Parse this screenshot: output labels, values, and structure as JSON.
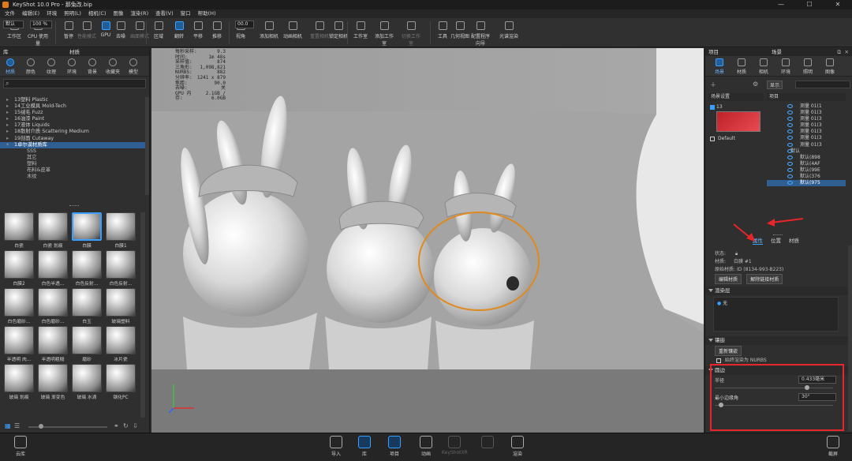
{
  "window": {
    "title": "KeyShot 10.0 Pro - 那兔改.bip",
    "controls": [
      "—",
      "☐",
      "✕"
    ]
  },
  "menu": [
    "文件",
    "编辑(E)",
    "环境",
    "照明(L)",
    "相机(C)",
    "图像",
    "渲染(R)",
    "查看(V)",
    "窗口",
    "帮助(H)"
  ],
  "toolbar": {
    "workspace_value": "默认",
    "cpu_value": "100 %",
    "focal_value": "00.0",
    "buttons": [
      {
        "label": "工作区",
        "state": "normal"
      },
      {
        "label": "CPU 使用量",
        "state": "normal"
      },
      {
        "label": "暂停",
        "state": "normal"
      },
      {
        "label": "性能模式",
        "state": "dim"
      },
      {
        "label": "GPU",
        "state": "active"
      },
      {
        "label": "去噪",
        "state": "normal"
      },
      {
        "label": "画面模式",
        "state": "dim"
      },
      {
        "label": "区域",
        "state": "normal"
      },
      {
        "label": "翻转",
        "state": "active"
      },
      {
        "label": "平移",
        "state": "normal"
      },
      {
        "label": "推移",
        "state": "normal"
      },
      {
        "label": "视角",
        "state": "normal"
      },
      {
        "label": "添加相机",
        "state": "normal"
      },
      {
        "label": "动画相机",
        "state": "normal"
      },
      {
        "label": "重置相机",
        "state": "dim"
      },
      {
        "label": "锁定相机",
        "state": "normal"
      },
      {
        "label": "工作室",
        "state": "normal"
      },
      {
        "label": "添加工作室",
        "state": "normal"
      },
      {
        "label": "切换工作室",
        "state": "dim"
      },
      {
        "label": "工具",
        "state": "normal"
      },
      {
        "label": "几何视图",
        "state": "normal"
      },
      {
        "label": "配置程序向导",
        "state": "normal"
      },
      {
        "label": "光谱渲染",
        "state": "normal"
      }
    ]
  },
  "library": {
    "header_left": "库",
    "header_title": "材质",
    "tabs": [
      {
        "label": "材质",
        "active": true,
        "icon": "material-icon"
      },
      {
        "label": "颜色",
        "active": false,
        "icon": "color-icon"
      },
      {
        "label": "纹理",
        "active": false,
        "icon": "texture-icon"
      },
      {
        "label": "环境",
        "active": false,
        "icon": "environment-icon"
      },
      {
        "label": "背景",
        "active": false,
        "icon": "background-icon"
      },
      {
        "label": "收藏夹",
        "active": false,
        "icon": "favorites-icon"
      },
      {
        "label": "模型",
        "active": false,
        "icon": "model-icon"
      }
    ],
    "tree": [
      {
        "label": "13塑料 Plastic",
        "type": "folder"
      },
      {
        "label": "14工业模具 Mold-Tech",
        "type": "folder"
      },
      {
        "label": "15绒毛 Fuzz",
        "type": "folder"
      },
      {
        "label": "16油漆 Paint",
        "type": "folder"
      },
      {
        "label": "17液体 Liquids",
        "type": "folder"
      },
      {
        "label": "18散射介质 Scattering Medium",
        "type": "folder"
      },
      {
        "label": "19剖面 Cutaway",
        "type": "folder"
      },
      {
        "label": "1卓尔谟材质库",
        "type": "selected"
      },
      {
        "label": "SSS",
        "type": "child"
      },
      {
        "label": "其它",
        "type": "child"
      },
      {
        "label": "塑料",
        "type": "child"
      },
      {
        "label": "布料&皮革",
        "type": "child"
      },
      {
        "label": "木纹",
        "type": "child"
      }
    ],
    "materials": [
      {
        "name": "白瓷",
        "sel": false
      },
      {
        "name": "白瓷 划痕",
        "sel": false
      },
      {
        "name": "白膜",
        "sel": true
      },
      {
        "name": "白膜1",
        "sel": false
      },
      {
        "name": "白膜2",
        "sel": false
      },
      {
        "name": "白色半透...",
        "sel": false
      },
      {
        "name": "白色反射...",
        "sel": false
      },
      {
        "name": "白色反射...",
        "sel": false
      },
      {
        "name": "白色磨砂...",
        "sel": false
      },
      {
        "name": "白色磨砂...",
        "sel": false
      },
      {
        "name": "白玉",
        "sel": false
      },
      {
        "name": "玻璃塑料",
        "sel": false
      },
      {
        "name": "半透明 肉...",
        "sel": false
      },
      {
        "name": "半透明粗糙",
        "sel": false
      },
      {
        "name": "磨砂",
        "sel": false
      },
      {
        "name": "冰片瓷",
        "sel": false
      },
      {
        "name": "玻璃 划痕",
        "sel": false
      },
      {
        "name": "玻璃 渐变色",
        "sel": false
      },
      {
        "name": "玻璃 水滴",
        "sel": false
      },
      {
        "name": "钢化PC",
        "sel": false
      }
    ]
  },
  "render_stats": [
    {
      "k": "每秒采样:",
      "v": "9.3"
    },
    {
      "k": "时间:",
      "v": "1m 48s"
    },
    {
      "k": "采样值:",
      "v": "874"
    },
    {
      "k": "三角形:",
      "v": "1,098,821"
    },
    {
      "k": "NURBS:",
      "v": "882"
    },
    {
      "k": "分辨率:",
      "v": "1241 x 879"
    },
    {
      "k": "焦距:",
      "v": "90.0"
    },
    {
      "k": "去噪:",
      "v": "关"
    },
    {
      "k": "GPU 内存:",
      "v": "2.1GB / 6.0GB"
    }
  ],
  "scene_panel": {
    "header_left": "项目",
    "header_title": "场景",
    "tabs": [
      {
        "label": "场景",
        "active": true
      },
      {
        "label": "材质",
        "active": false
      },
      {
        "label": "相机",
        "active": false
      },
      {
        "label": "环境",
        "active": false
      },
      {
        "label": "照明",
        "active": false
      },
      {
        "label": "图像",
        "active": false
      }
    ],
    "show_button": "显示",
    "scene_settings_title": "场景设置",
    "items_title": "项目",
    "settings": [
      {
        "label": "13",
        "checked": true
      },
      {
        "label": "Default",
        "checked": false
      }
    ],
    "items": [
      {
        "label": "测量 01(1",
        "sel": false
      },
      {
        "label": "测量 01(3",
        "sel": false
      },
      {
        "label": "测量 01(3",
        "sel": false
      },
      {
        "label": "测量 01(3",
        "sel": false
      },
      {
        "label": "测量 01(3",
        "sel": false
      },
      {
        "label": "测量 01(3",
        "sel": false
      },
      {
        "label": "测量 01(3",
        "sel": false
      },
      {
        "label": "默认",
        "sel": false
      },
      {
        "label": "默认(898",
        "sel": false
      },
      {
        "label": "默认(4AF",
        "sel": false
      },
      {
        "label": "默认(99E",
        "sel": false
      },
      {
        "label": "默认(376",
        "sel": false
      },
      {
        "label": "默认(975",
        "sel": true
      }
    ],
    "sub_tabs": [
      "属性",
      "位置",
      "材质"
    ],
    "state_label": "状态:",
    "material_label": "材质:",
    "material_value": "白膜 #1",
    "source_label": "原始材质:",
    "source_value": "ID (8134-993-B223)",
    "edit_material_btn": "编辑材质",
    "unlink_material_btn": "解除链接材质",
    "render_layers_title": "渲染层",
    "render_layer_value": "无",
    "tessellation_title": "镶嵌",
    "retessellate_btn": "重新镶嵌",
    "render_as_nurbs": "始终渲染为 NURBS",
    "round_edge_title": "圆边",
    "radius_label": "半径",
    "radius_value": "0.433毫米",
    "min_angle_label": "最小边缘角",
    "min_angle_value": "30°",
    "radius_level": 0.78,
    "min_angle_level": 0.05
  },
  "bottom_bar": [
    {
      "label": "云库",
      "state": "normal"
    },
    {
      "label": "导入",
      "state": "normal"
    },
    {
      "label": "库",
      "state": "active"
    },
    {
      "label": "项目",
      "state": "active"
    },
    {
      "label": "动画",
      "state": "normal"
    },
    {
      "label": "KeyShotXR",
      "state": "dim"
    },
    {
      "label": "",
      "state": "dim"
    },
    {
      "label": "渲染",
      "state": "normal"
    },
    {
      "label": "截屏",
      "state": "normal"
    }
  ]
}
